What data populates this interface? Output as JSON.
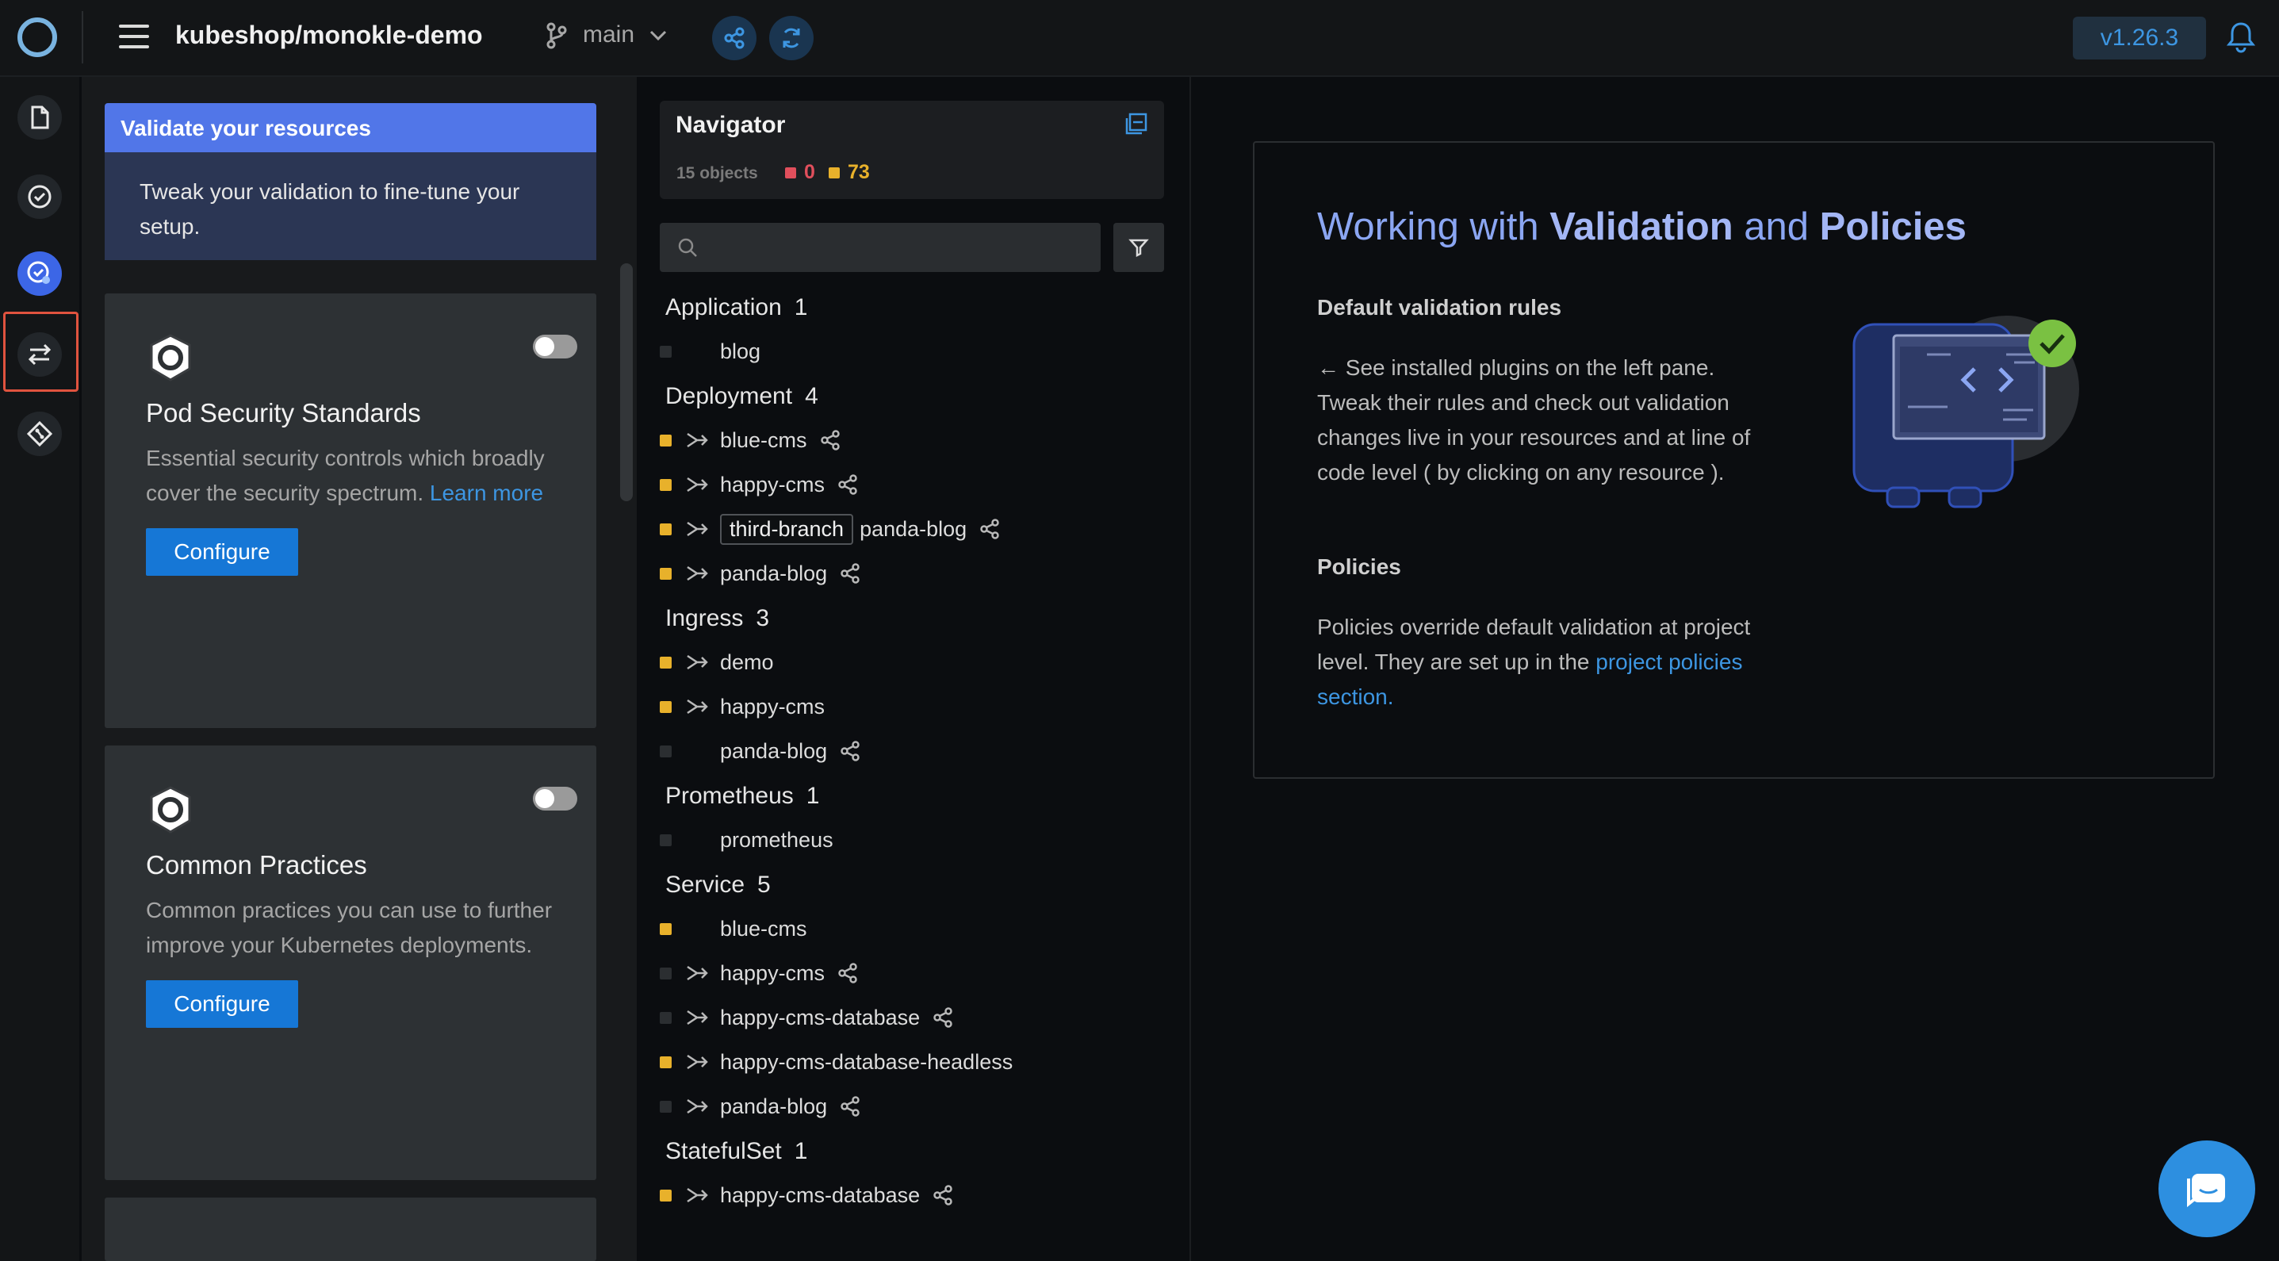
{
  "topbar": {
    "project": "kubeshop/monokle-demo",
    "branch": "main",
    "version": "v1.26.3"
  },
  "activity_bar": {
    "items": [
      "file-explorer",
      "validation-check",
      "validation-settings",
      "compare",
      "git"
    ],
    "active": "validation-settings"
  },
  "validation_pane": {
    "banner_title": "Validate your resources",
    "banner_text": "Tweak your validation to fine-tune your setup.",
    "cards": [
      {
        "title": "Pod Security Standards",
        "description": "Essential security controls which broadly cover the security spectrum.",
        "link": "Learn more",
        "button": "Configure",
        "enabled": false
      },
      {
        "title": "Common Practices",
        "description": "Common practices you can use to further improve your Kubernetes deployments.",
        "button": "Configure",
        "enabled": false
      }
    ]
  },
  "navigator": {
    "title": "Navigator",
    "object_count": "15 objects",
    "errors": "0",
    "warnings": "73",
    "search_placeholder": "",
    "groups": [
      {
        "name": "Application",
        "count": "1",
        "items": [
          {
            "name": "blog",
            "status": "none",
            "tree": false,
            "share": false
          }
        ]
      },
      {
        "name": "Deployment",
        "count": "4",
        "items": [
          {
            "name": "blue-cms",
            "status": "warning",
            "tree": true,
            "share": true
          },
          {
            "name": "happy-cms",
            "status": "warning",
            "tree": true,
            "share": true
          },
          {
            "name": "panda-blog",
            "status": "warning",
            "tree": true,
            "share": true,
            "tag": "third-branch"
          },
          {
            "name": "panda-blog",
            "status": "warning",
            "tree": true,
            "share": true
          }
        ]
      },
      {
        "name": "Ingress",
        "count": "3",
        "items": [
          {
            "name": "demo",
            "status": "warning",
            "tree": true,
            "share": false
          },
          {
            "name": "happy-cms",
            "status": "warning",
            "tree": true,
            "share": false
          },
          {
            "name": "panda-blog",
            "status": "none",
            "tree": false,
            "share": true
          }
        ]
      },
      {
        "name": "Prometheus",
        "count": "1",
        "items": [
          {
            "name": "prometheus",
            "status": "none",
            "tree": false,
            "share": false
          }
        ]
      },
      {
        "name": "Service",
        "count": "5",
        "items": [
          {
            "name": "blue-cms",
            "status": "warning",
            "tree": false,
            "share": false
          },
          {
            "name": "happy-cms",
            "status": "none",
            "tree": true,
            "share": true
          },
          {
            "name": "happy-cms-database",
            "status": "none",
            "tree": true,
            "share": true
          },
          {
            "name": "happy-cms-database-headless",
            "status": "warning",
            "tree": true,
            "share": false
          },
          {
            "name": "panda-blog",
            "status": "none",
            "tree": true,
            "share": true
          }
        ]
      },
      {
        "name": "StatefulSet",
        "count": "1",
        "items": [
          {
            "name": "happy-cms-database",
            "status": "warning",
            "tree": true,
            "share": true
          }
        ]
      }
    ]
  },
  "info_panel": {
    "title_pre": "Working with",
    "title_b1": "Validation",
    "title_mid": "and",
    "title_b2": "Policies",
    "section1_title": "Default validation rules",
    "section1_text": "← See installed plugins on the left pane. Tweak their rules and check out validation changes live in your resources and at line of code level ( by clicking on any resource ).",
    "section2_title": "Policies",
    "section2_text": "Policies override default validation at project level. They are set up in the",
    "section2_link": "project policies section."
  },
  "colors": {
    "accent": "#3c66e6",
    "link": "#3d96e2",
    "warning": "#e8b12b",
    "error": "#e04f5c",
    "title": "#8ba6f2"
  }
}
